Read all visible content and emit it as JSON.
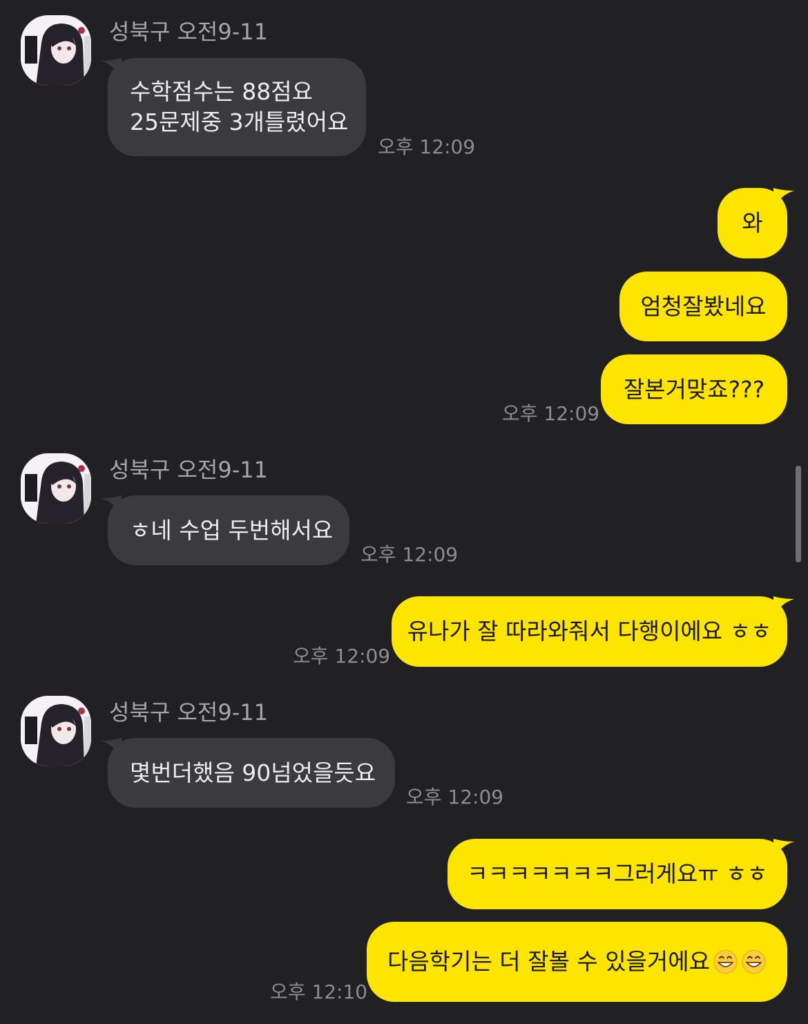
{
  "colors": {
    "background": "#212124",
    "incoming_bubble": "#3b3b3e",
    "outgoing_bubble": "#fee500",
    "sender_name": "#a7a7ab",
    "timestamp": "#8d8d91"
  },
  "messages": [
    {
      "type": "incoming",
      "sender": "성북구 오전9-11",
      "lines": [
        "수학점수는 88점요",
        "25문제중 3개틀렸어요"
      ],
      "time": "오후 12:09"
    },
    {
      "type": "outgoing",
      "text": "와",
      "time": ""
    },
    {
      "type": "outgoing",
      "text": "엄청잘봤네요",
      "time": ""
    },
    {
      "type": "outgoing",
      "text": "잘본거맞죠???",
      "time": "오후 12:09"
    },
    {
      "type": "incoming",
      "sender": "성북구 오전9-11",
      "text": "ㅎ네 수업 두번해서요",
      "time": "오후 12:09"
    },
    {
      "type": "outgoing",
      "text": "유나가 잘 따라와줘서 다행이에요 ㅎㅎ",
      "time": "오후 12:09"
    },
    {
      "type": "incoming",
      "sender": "성북구 오전9-11",
      "text": "몇번더했음 90넘었을듯요",
      "time": "오후 12:09"
    },
    {
      "type": "outgoing",
      "text": "ㅋㅋㅋㅋㅋㅋㅋ그러게요ㅠ ㅎㅎ",
      "time": ""
    },
    {
      "type": "outgoing",
      "text": "다음학기는 더 잘볼 수 있을거에요",
      "emoji": [
        "grinning-face-emoji",
        "grinning-face-emoji"
      ],
      "time": "오후 12:10"
    }
  ]
}
